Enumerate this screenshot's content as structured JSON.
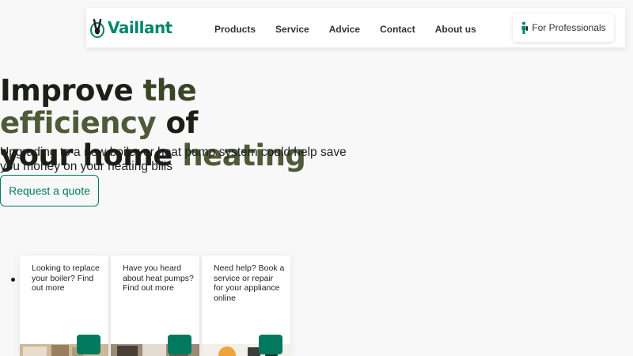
{
  "header": {
    "logo_text": "Vaillant",
    "nav": [
      "Products",
      "Service",
      "Advice",
      "Contact",
      "About us"
    ],
    "professionals_label": "For Professionals"
  },
  "hero": {
    "title_line1_part1": "Improve",
    "title_line1_part2": "the",
    "title_line1_part3": "efficiency",
    "title_line1_part4": "of",
    "title_line2_part1": "your home",
    "title_line2_part2": "heating",
    "subtitle": "Upgrading to a new boiler or heat pump system could help save you money on your heating bills",
    "cta_label": "Request a quote"
  },
  "cards": [
    {
      "text": "Looking to replace your boiler? Find out more"
    },
    {
      "text": "Have you heard about heat pumps? Find out more"
    },
    {
      "text": "Need help? Book a service or repair for your appliance online"
    }
  ],
  "colors": {
    "brand_green": "#00856a",
    "button_green": "#00795f",
    "background": "#f8f8f8"
  }
}
